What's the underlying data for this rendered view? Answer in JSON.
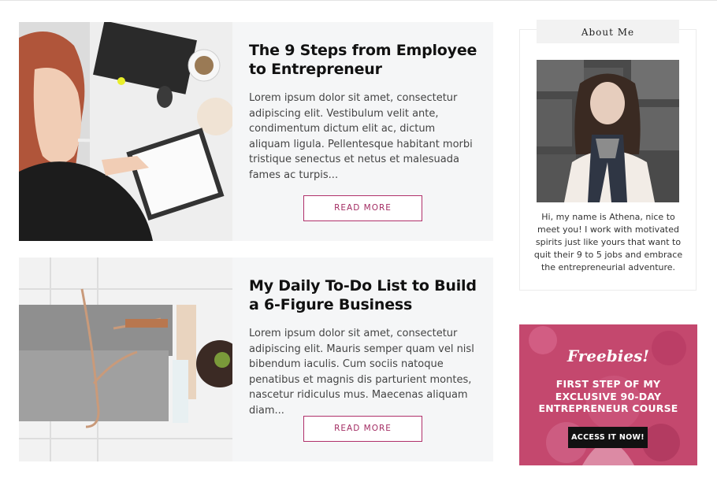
{
  "posts": [
    {
      "title": "The 9 Steps from Employee to Entrepreneur",
      "excerpt": "Lorem ipsum dolor sit amet, consectetur adipiscing elit. Vestibulum velit ante, condimentum dictum elit ac, dictum aliquam ligula. Pellentesque habitant morbi tristique senectus et netus et malesuada fames ac turpis...",
      "button_label": "READ MORE"
    },
    {
      "title": "My Daily To-Do List to Build a 6-Figure Business",
      "excerpt": "Lorem ipsum dolor sit amet, consectetur adipiscing elit. Mauris semper quam vel nisl bibendum iaculis. Cum sociis natoque penatibus et magnis dis parturient montes, nascetur ridiculus mus. Maecenas aliquam diam...",
      "button_label": "READ MORE"
    }
  ],
  "sidebar": {
    "about": {
      "heading": "About Me",
      "text": "Hi, my name is Athena, nice to meet you! I work with motivated spirits just like yours that want to quit their 9 to 5 jobs and embrace the entrepreneurial adventure."
    },
    "freebie": {
      "script_title": "Freebies!",
      "headline": "FIRST STEP OF MY EXCLUSIVE 90-DAY ENTREPRENEUR COURSE",
      "cta_label": "ACCESS IT NOW!"
    }
  },
  "colors": {
    "accent": "#a32d63",
    "card_background": "#f5f6f7",
    "freebie_overlay": "#c4486e"
  }
}
